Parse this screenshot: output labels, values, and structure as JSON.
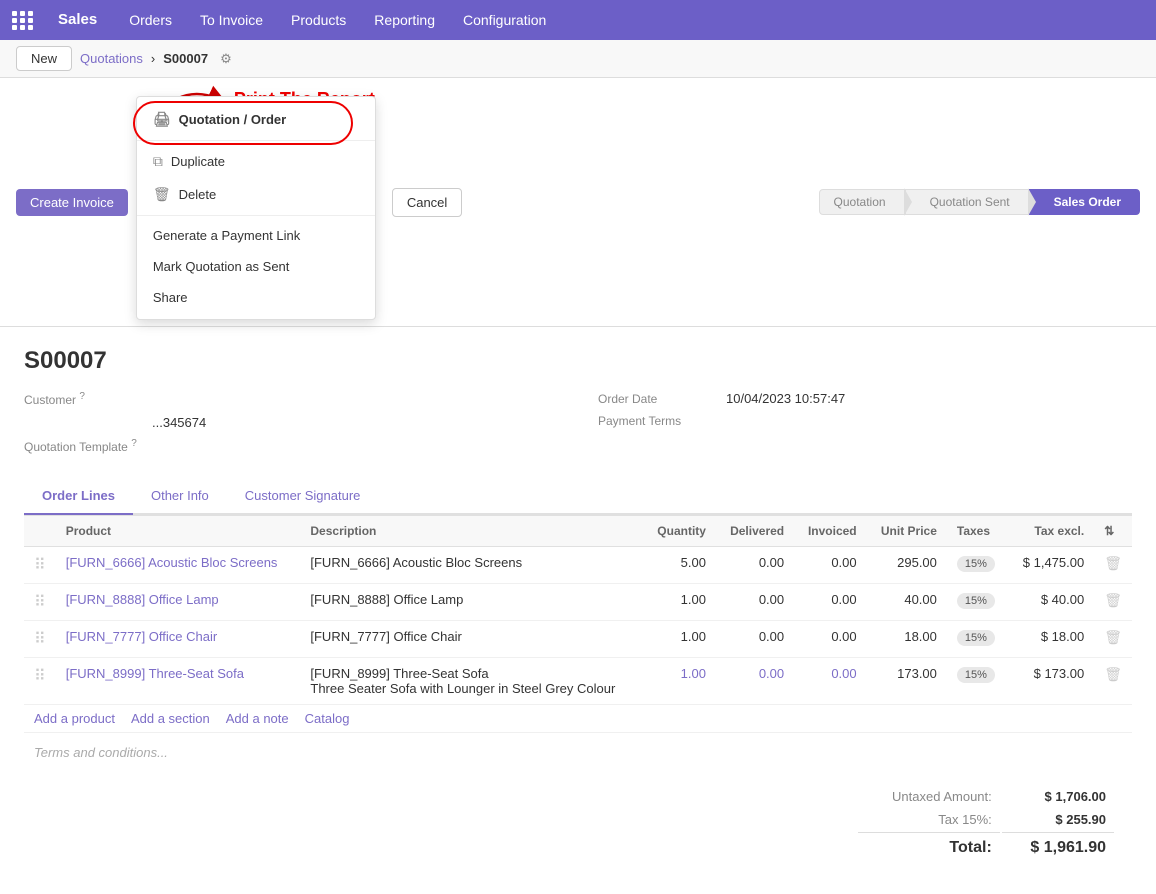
{
  "topnav": {
    "app_label": "Sales",
    "items": [
      "Orders",
      "To Invoice",
      "Products",
      "Reporting",
      "Configuration"
    ]
  },
  "breadcrumb": {
    "new_label": "New",
    "parent": "Quotations",
    "record": "S00007"
  },
  "toolbar": {
    "create_invoice_label": "Create Invoice",
    "cancel_label": "Cancel",
    "dropdown": {
      "print_label": "Quotation / Order",
      "duplicate_label": "Duplicate",
      "delete_label": "Delete",
      "payment_link_label": "Generate a Payment Link",
      "mark_sent_label": "Mark Quotation as Sent",
      "share_label": "Share"
    },
    "annotation": "Print The Report"
  },
  "status_steps": [
    "Quotation",
    "Quotation Sent",
    "Sales Order"
  ],
  "order": {
    "id": "S00007",
    "customer_label": "Customer",
    "customer_help": "?",
    "customer_value": "",
    "address_value": "...345674",
    "order_date_label": "Order Date",
    "order_date_value": "10/04/2023 10:57:47",
    "payment_terms_label": "Payment Terms",
    "payment_terms_value": "",
    "quotation_template_label": "Quotation Template",
    "quotation_template_help": "?"
  },
  "tabs": [
    {
      "id": "order-lines",
      "label": "Order Lines",
      "active": true
    },
    {
      "id": "other-info",
      "label": "Other Info",
      "active": false
    },
    {
      "id": "customer-signature",
      "label": "Customer Signature",
      "active": false
    }
  ],
  "table": {
    "columns": [
      "Product",
      "Description",
      "Quantity",
      "Delivered",
      "Invoiced",
      "Unit Price",
      "Taxes",
      "Tax excl."
    ],
    "rows": [
      {
        "product": "[FURN_6666] Acoustic Bloc Screens",
        "description": "[FURN_6666] Acoustic Bloc Screens",
        "quantity": "5.00",
        "delivered": "0.00",
        "invoiced": "0.00",
        "unit_price": "295.00",
        "taxes": "15%",
        "tax_excl": "$ 1,475.00",
        "highlight": false
      },
      {
        "product": "[FURN_8888] Office Lamp",
        "description": "[FURN_8888] Office Lamp",
        "quantity": "1.00",
        "delivered": "0.00",
        "invoiced": "0.00",
        "unit_price": "40.00",
        "taxes": "15%",
        "tax_excl": "$ 40.00",
        "highlight": false
      },
      {
        "product": "[FURN_7777] Office Chair",
        "description": "[FURN_7777] Office Chair",
        "quantity": "1.00",
        "delivered": "0.00",
        "invoiced": "0.00",
        "unit_price": "18.00",
        "taxes": "15%",
        "tax_excl": "$ 18.00",
        "highlight": false
      },
      {
        "product": "[FURN_8999] Three-Seat Sofa",
        "description": "[FURN_8999] Three-Seat Sofa\nThree Seater Sofa with Lounger in Steel Grey Colour",
        "quantity": "1.00",
        "delivered": "0.00",
        "invoiced": "0.00",
        "unit_price": "173.00",
        "taxes": "15%",
        "tax_excl": "$ 173.00",
        "highlight": true
      }
    ],
    "footer": {
      "add_product": "Add a product",
      "add_section": "Add a section",
      "add_note": "Add a note",
      "catalog": "Catalog"
    }
  },
  "terms_placeholder": "Terms and conditions...",
  "totals": {
    "untaxed_label": "Untaxed Amount:",
    "untaxed_value": "$ 1,706.00",
    "tax_label": "Tax 15%:",
    "tax_value": "$ 255.90",
    "total_label": "Total:",
    "total_value": "$ 1,961.90"
  }
}
